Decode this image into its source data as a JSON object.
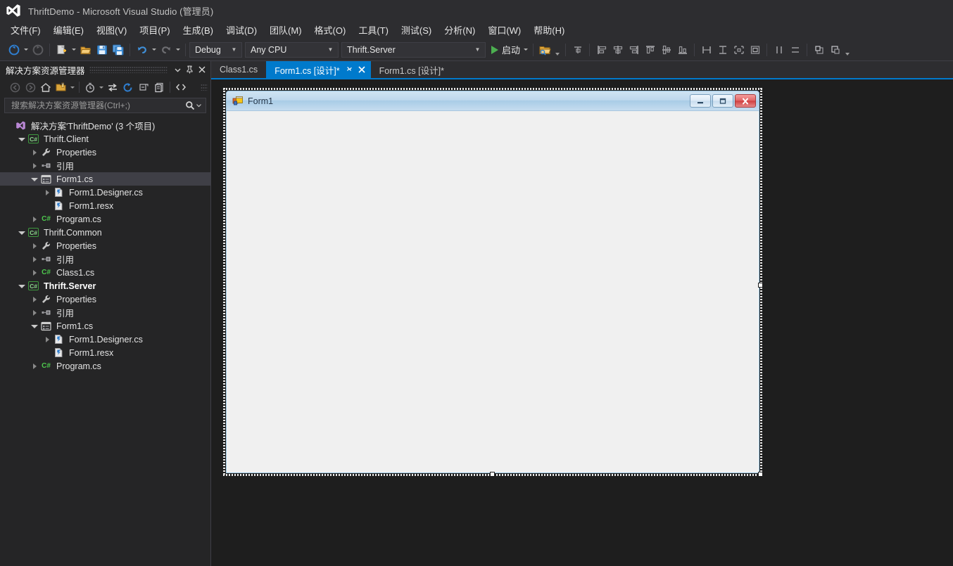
{
  "window": {
    "title": "ThriftDemo - Microsoft Visual Studio (管理员)",
    "logo_icon": "visual-studio-logo-icon"
  },
  "menubar": {
    "items": [
      {
        "label": "文件(F)"
      },
      {
        "label": "编辑(E)"
      },
      {
        "label": "视图(V)"
      },
      {
        "label": "项目(P)"
      },
      {
        "label": "生成(B)"
      },
      {
        "label": "调试(D)"
      },
      {
        "label": "团队(M)"
      },
      {
        "label": "格式(O)"
      },
      {
        "label": "工具(T)"
      },
      {
        "label": "测试(S)"
      },
      {
        "label": "分析(N)"
      },
      {
        "label": "窗口(W)"
      },
      {
        "label": "帮助(H)"
      }
    ]
  },
  "toolbar": {
    "navigate_back_icon": "navigate-back-icon",
    "navigate_forward_icon": "navigate-forward-icon",
    "new_project_icon": "new-project-icon",
    "open_file_icon": "open-file-icon",
    "save_icon": "save-icon",
    "save_all_icon": "save-all-icon",
    "undo_icon": "undo-icon",
    "redo_icon": "redo-icon",
    "config_value": "Debug",
    "platform_value": "Any CPU",
    "startup_project_value": "Thrift.Server",
    "run_label": "启动",
    "run_icon": "play-icon",
    "solution_explorer_icon": "solution-explorer-icon",
    "align_tool_icon": "align-to-grid-icon",
    "align_lefts_icon": "align-lefts-icon",
    "align_centers_icon": "align-centers-icon",
    "align_rights_icon": "align-rights-icon",
    "align_tops_icon": "align-tops-icon",
    "align_middles_icon": "align-middles-icon",
    "align_bottoms_icon": "align-bottoms-icon",
    "make_same_width_icon": "make-same-width-icon",
    "make_same_height_icon": "make-same-height-icon",
    "make_same_size_icon": "make-same-size-icon",
    "size_to_grid_icon": "size-to-grid-icon",
    "horiz_spacing_icon": "horizontal-spacing-icon",
    "vert_spacing_icon": "vertical-spacing-icon",
    "bring_to_front_icon": "bring-to-front-icon",
    "send_to_back_icon": "send-to-back-icon",
    "overflow_icon": "toolbar-overflow-icon"
  },
  "solution_explorer": {
    "title": "解决方案资源管理器",
    "header_buttons": {
      "dropdown_icon": "chevron-down-icon",
      "pin_icon": "pin-icon",
      "close_icon": "close-icon"
    },
    "toolbar_icons": [
      "back-icon",
      "forward-icon",
      "home-icon",
      "pending-changes-filter-icon",
      "chevron-down-icon",
      "recent-files-icon",
      "chevron-down-icon",
      "sync-with-active-document-icon",
      "refresh-icon",
      "collapse-all-icon",
      "show-all-files-icon",
      "view-code-icon"
    ],
    "search_placeholder": "搜索解决方案资源管理器(Ctrl+;)",
    "search_value": "",
    "search_icon": "search-icon",
    "search_dropdown_icon": "chevron-down-icon",
    "tree": [
      {
        "label": "解决方案'ThriftDemo' (3 个项目)",
        "icon": "solution-icon",
        "indent": 0,
        "twisty": "none",
        "selected": false,
        "bold": false
      },
      {
        "label": "Thrift.Client",
        "icon": "csharp-project-icon",
        "indent": 1,
        "twisty": "expanded",
        "selected": false,
        "bold": false
      },
      {
        "label": "Properties",
        "icon": "properties-wrench-icon",
        "indent": 2,
        "twisty": "collapsed",
        "selected": false,
        "bold": false
      },
      {
        "label": "引用",
        "icon": "references-icon",
        "indent": 2,
        "twisty": "collapsed",
        "selected": false,
        "bold": false
      },
      {
        "label": "Form1.cs",
        "icon": "windows-form-icon",
        "indent": 2,
        "twisty": "expanded",
        "selected": true,
        "bold": false
      },
      {
        "label": "Form1.Designer.cs",
        "icon": "code-file-icon",
        "indent": 3,
        "twisty": "collapsed",
        "selected": false,
        "bold": false
      },
      {
        "label": "Form1.resx",
        "icon": "code-file-icon",
        "indent": 3,
        "twisty": "none",
        "selected": false,
        "bold": false
      },
      {
        "label": "Program.cs",
        "icon": "csharp-file-icon",
        "indent": 2,
        "twisty": "collapsed",
        "selected": false,
        "bold": false
      },
      {
        "label": "Thrift.Common",
        "icon": "csharp-project-icon",
        "indent": 1,
        "twisty": "expanded",
        "selected": false,
        "bold": false
      },
      {
        "label": "Properties",
        "icon": "properties-wrench-icon",
        "indent": 2,
        "twisty": "collapsed",
        "selected": false,
        "bold": false
      },
      {
        "label": "引用",
        "icon": "references-icon",
        "indent": 2,
        "twisty": "collapsed",
        "selected": false,
        "bold": false
      },
      {
        "label": "Class1.cs",
        "icon": "csharp-file-icon",
        "indent": 2,
        "twisty": "collapsed",
        "selected": false,
        "bold": false
      },
      {
        "label": "Thrift.Server",
        "icon": "csharp-project-icon",
        "indent": 1,
        "twisty": "expanded",
        "selected": false,
        "bold": true
      },
      {
        "label": "Properties",
        "icon": "properties-wrench-icon",
        "indent": 2,
        "twisty": "collapsed",
        "selected": false,
        "bold": false
      },
      {
        "label": "引用",
        "icon": "references-icon",
        "indent": 2,
        "twisty": "collapsed",
        "selected": false,
        "bold": false
      },
      {
        "label": "Form1.cs",
        "icon": "windows-form-icon",
        "indent": 2,
        "twisty": "expanded",
        "selected": false,
        "bold": false
      },
      {
        "label": "Form1.Designer.cs",
        "icon": "code-file-icon",
        "indent": 3,
        "twisty": "collapsed",
        "selected": false,
        "bold": false
      },
      {
        "label": "Form1.resx",
        "icon": "code-file-icon",
        "indent": 3,
        "twisty": "none",
        "selected": false,
        "bold": false
      },
      {
        "label": "Program.cs",
        "icon": "csharp-file-icon",
        "indent": 2,
        "twisty": "collapsed",
        "selected": false,
        "bold": false
      }
    ]
  },
  "editor": {
    "tabs": [
      {
        "label": "Class1.cs",
        "active": false,
        "has_close": false,
        "has_pin": false
      },
      {
        "label": "Form1.cs [设计]*",
        "active": true,
        "has_close": true,
        "has_pin": true,
        "pin_icon": "pin-icon",
        "close_icon": "close-icon"
      },
      {
        "label": "Form1.cs [设计]*",
        "active": false,
        "has_close": false,
        "has_pin": false
      }
    ]
  },
  "designer_form": {
    "title": "Form1",
    "icon": "windows-form-icon",
    "minimize_icon": "minimize-icon",
    "maximize_icon": "maximize-icon",
    "close_icon": "close-icon"
  },
  "colors": {
    "accent": "#007acc",
    "chrome_bg": "#2d2d30",
    "panel_bg": "#252526",
    "editor_bg": "#1e1e1e",
    "selection": "#3f3f46",
    "text": "#e4e4e4",
    "run_green": "#4caf50",
    "form_client": "#f0f0f0"
  }
}
